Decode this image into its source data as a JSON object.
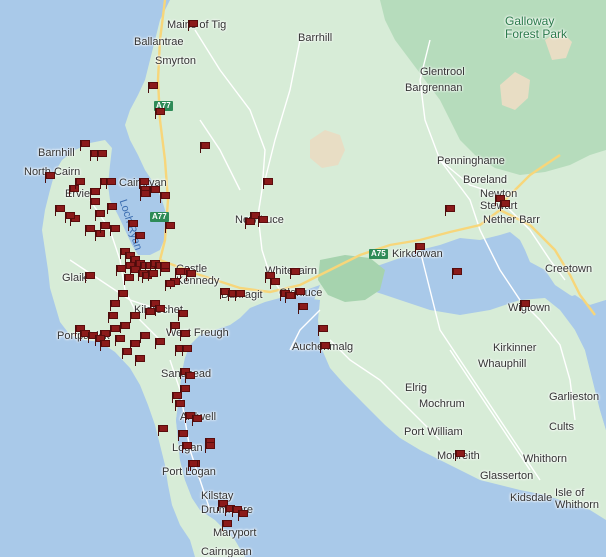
{
  "map": {
    "colors": {
      "sea": "#a9c9e9",
      "land": "#d7ecd7",
      "forest": "#b6dcbc",
      "road": "#ffffff",
      "a_road": "#f7d67a",
      "flag": "#8b1a1a"
    },
    "places": [
      {
        "id": "mains-of-tig",
        "label": "Mains of Tig",
        "kind": "town"
      },
      {
        "id": "ballantrae",
        "label": "Ballantrae",
        "kind": "town"
      },
      {
        "id": "smyrton",
        "label": "Smyrton",
        "kind": "town"
      },
      {
        "id": "barrhill",
        "label": "Barrhill",
        "kind": "town"
      },
      {
        "id": "glentrool",
        "label": "Glentrool",
        "kind": "town"
      },
      {
        "id": "bargrennan",
        "label": "Bargrennan",
        "kind": "town"
      },
      {
        "id": "galloway-forest-park",
        "label": "Galloway\nForest Park",
        "kind": "park"
      },
      {
        "id": "barnhill",
        "label": "Barnhill",
        "kind": "town"
      },
      {
        "id": "north-cairn",
        "label": "North Cairn",
        "kind": "town"
      },
      {
        "id": "cairnryan",
        "label": "Cairnryan",
        "kind": "town"
      },
      {
        "id": "ervie",
        "label": "Ervie",
        "kind": "town"
      },
      {
        "id": "loch-ryan",
        "label": "Loch Ryan",
        "kind": "water"
      },
      {
        "id": "new-luce",
        "label": "New Luce",
        "kind": "town"
      },
      {
        "id": "penninghame",
        "label": "Penninghame",
        "kind": "town"
      },
      {
        "id": "boreland",
        "label": "Boreland",
        "kind": "town"
      },
      {
        "id": "newton-stewart",
        "label": "Newton\nStewart",
        "kind": "town"
      },
      {
        "id": "nether-barr",
        "label": "Nether Barr",
        "kind": "town"
      },
      {
        "id": "kirkcowan",
        "label": "Kirkcowan",
        "kind": "town"
      },
      {
        "id": "creetown",
        "label": "Creetown",
        "kind": "town"
      },
      {
        "id": "glaik",
        "label": "Glaik",
        "kind": "town"
      },
      {
        "id": "castle-kennedy",
        "label": "Castle\nKennedy",
        "kind": "town"
      },
      {
        "id": "whitecairn",
        "label": "Whitecairn",
        "kind": "town"
      },
      {
        "id": "dunragit",
        "label": "Dunragit",
        "kind": "town"
      },
      {
        "id": "glenluce",
        "label": "Glenluce",
        "kind": "town"
      },
      {
        "id": "kildrochet",
        "label": "Kildrochet",
        "kind": "town"
      },
      {
        "id": "west-freugh",
        "label": "West Freugh",
        "kind": "town"
      },
      {
        "id": "portpatrick",
        "label": "Portpatrick",
        "kind": "town"
      },
      {
        "id": "auchenmalg",
        "label": "Auchenmalg",
        "kind": "town"
      },
      {
        "id": "wigtown",
        "label": "Wigtown",
        "kind": "town"
      },
      {
        "id": "sandhead",
        "label": "Sandhead",
        "kind": "town"
      },
      {
        "id": "kirkinner",
        "label": "Kirkinner",
        "kind": "town"
      },
      {
        "id": "whauphill",
        "label": "Whauphill",
        "kind": "town"
      },
      {
        "id": "ardwell",
        "label": "Ardwell",
        "kind": "town"
      },
      {
        "id": "elrig",
        "label": "Elrig",
        "kind": "town"
      },
      {
        "id": "mochrum",
        "label": "Mochrum",
        "kind": "town"
      },
      {
        "id": "garlieston",
        "label": "Garlieston",
        "kind": "town"
      },
      {
        "id": "logan",
        "label": "Logan",
        "kind": "town"
      },
      {
        "id": "port-william",
        "label": "Port William",
        "kind": "town"
      },
      {
        "id": "cults",
        "label": "Cults",
        "kind": "town"
      },
      {
        "id": "monreith",
        "label": "Monreith",
        "kind": "town"
      },
      {
        "id": "whithorn",
        "label": "Whithorn",
        "kind": "town"
      },
      {
        "id": "port-logan",
        "label": "Port Logan",
        "kind": "town"
      },
      {
        "id": "glasserton",
        "label": "Glasserton",
        "kind": "town"
      },
      {
        "id": "kidsdale",
        "label": "Kidsdale",
        "kind": "town"
      },
      {
        "id": "isle-of-whithorn",
        "label": "Isle of\nWhithorn",
        "kind": "town"
      },
      {
        "id": "kilstay",
        "label": "Kilstay",
        "kind": "town"
      },
      {
        "id": "drummore",
        "label": "Drummore",
        "kind": "town"
      },
      {
        "id": "maryport",
        "label": "Maryport",
        "kind": "town"
      },
      {
        "id": "cairngaan",
        "label": "Cairngaan",
        "kind": "town"
      }
    ],
    "road_shields": [
      {
        "id": "a77-north",
        "label": "A77"
      },
      {
        "id": "a77-south",
        "label": "A77"
      },
      {
        "id": "a75",
        "label": "A75"
      }
    ],
    "marker_count": 124,
    "marker_icon": "red-flag-icon"
  }
}
